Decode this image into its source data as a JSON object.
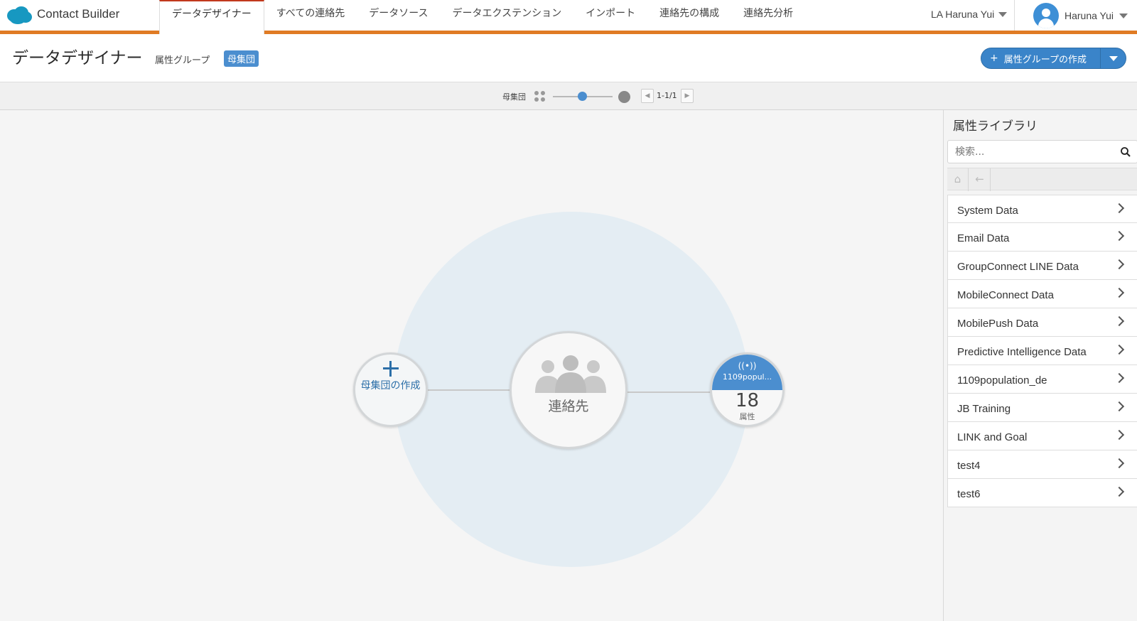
{
  "app": {
    "name": "Contact Builder"
  },
  "nav": {
    "tabs": [
      {
        "label": "データデザイナー",
        "active": true
      },
      {
        "label": "すべての連絡先"
      },
      {
        "label": "データソース"
      },
      {
        "label": "データエクステンション"
      },
      {
        "label": "インポート"
      },
      {
        "label": "連絡先の構成"
      },
      {
        "label": "連絡先分析"
      }
    ],
    "business_unit": "LA Haruna Yui",
    "user_name": "Haruna Yui"
  },
  "header": {
    "title": "データデザイナー",
    "breadcrumb": "属性グループ",
    "badge": "母集団",
    "create_button": "属性グループの作成",
    "create_plus": "+"
  },
  "toolbar": {
    "label": "母集団",
    "page_text": "1-1/1",
    "zoom_level": 0.5
  },
  "canvas": {
    "create_node_label": "母集団の作成",
    "contact_node_label": "連絡先",
    "population_node": {
      "name": "1109popul...",
      "count": "18",
      "unit": "属性",
      "icon": "broadcast-icon"
    }
  },
  "sidebar": {
    "title": "属性ライブラリ",
    "search_placeholder": "検索...",
    "items": [
      {
        "label": "System Data"
      },
      {
        "label": "Email Data"
      },
      {
        "label": "GroupConnect LINE Data"
      },
      {
        "label": "MobileConnect Data"
      },
      {
        "label": "MobilePush Data"
      },
      {
        "label": "Predictive Intelligence Data"
      },
      {
        "label": "1109population_de"
      },
      {
        "label": "JB Training"
      },
      {
        "label": "LINK and Goal"
      },
      {
        "label": "test4"
      },
      {
        "label": "test6"
      }
    ]
  },
  "colors": {
    "accent": "#e07b24",
    "brand_blue": "#4b8ecf",
    "active_tab_border": "#c1391d"
  }
}
